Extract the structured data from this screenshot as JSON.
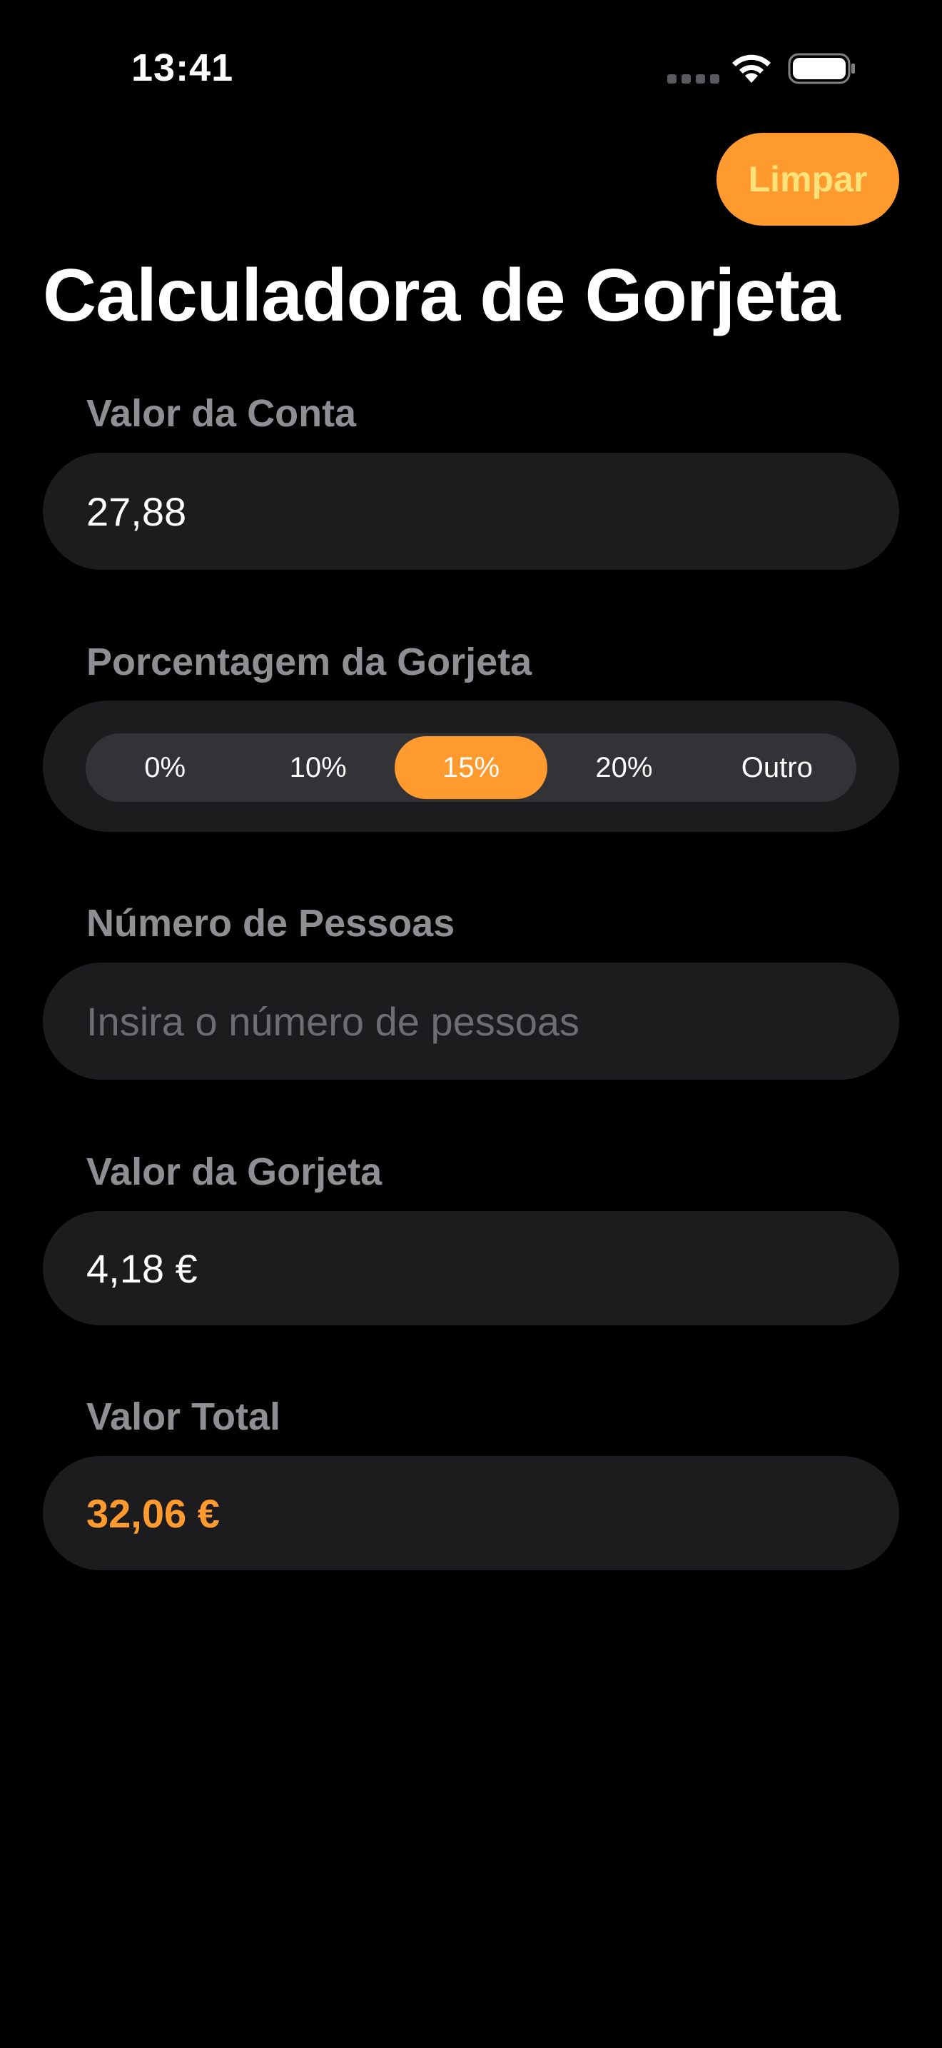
{
  "status_bar": {
    "time": "13:41",
    "icons": [
      "cellular-dots-icon",
      "wifi-icon",
      "battery-icon"
    ]
  },
  "header": {
    "clear_label": "Limpar",
    "title": "Calculadora de Gorjeta"
  },
  "bill": {
    "label": "Valor da Conta",
    "value": "27,88"
  },
  "tip_percentage": {
    "label": "Porcentagem da Gorjeta",
    "options": [
      "0%",
      "10%",
      "15%",
      "20%",
      "Outro"
    ],
    "selected": "15%"
  },
  "people": {
    "label": "Número de Pessoas",
    "value": "",
    "placeholder": "Insira o número de pessoas"
  },
  "tip_amount": {
    "label": "Valor da Gorjeta",
    "value": "4,18 €"
  },
  "total": {
    "label": "Valor Total",
    "value": "32,06 €"
  },
  "colors": {
    "accent": "#ff9a2e",
    "accent_text": "#ffe27a",
    "background": "#000000",
    "field_background": "#1c1c1e",
    "label": "#8e8e93",
    "placeholder": "#6d6d72"
  }
}
